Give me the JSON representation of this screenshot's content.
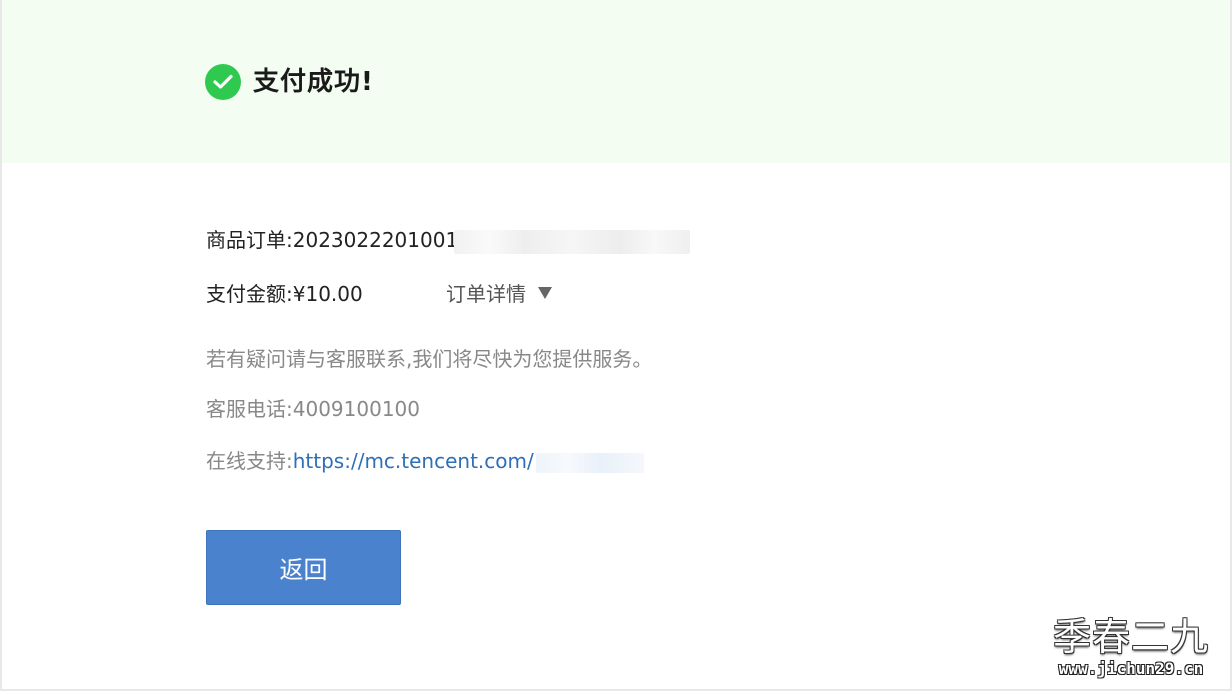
{
  "banner": {
    "icon": "check-circle-icon",
    "title": "支付成功!",
    "color": "#2fc94f",
    "background": "#f3fdf1"
  },
  "order": {
    "label": "商品订单:",
    "value": "2023022201001"
  },
  "amount": {
    "label": "支付金额:",
    "value": "¥10.00"
  },
  "details": {
    "label": "订单详情",
    "icon": "caret-down-icon"
  },
  "notice": "若有疑问请与客服联系,我们将尽快为您提供服务。",
  "phone": {
    "label": "客服电话:",
    "value": "4009100100"
  },
  "support": {
    "label": "在线支持:",
    "link": "https://mc.tencent.com/",
    "link_color": "#2e6fb7"
  },
  "back_button": {
    "label": "返回",
    "color": "#4a82cd"
  },
  "watermark": {
    "text": "季春二九",
    "url": "www.jichun29.cn"
  }
}
